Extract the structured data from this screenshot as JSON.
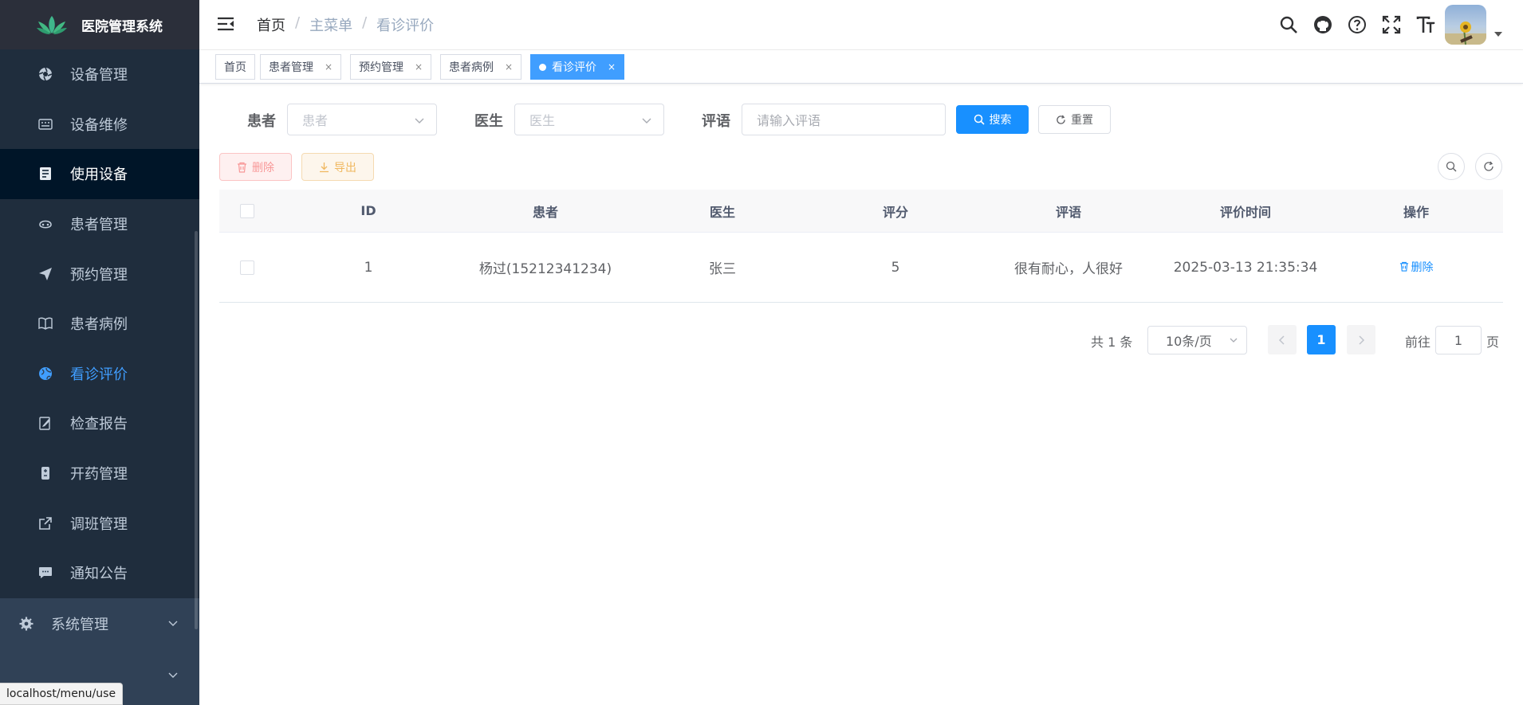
{
  "app": {
    "title": "医院管理系统"
  },
  "sidebar": {
    "items": [
      {
        "label": "设备管理",
        "icon": "aperture-icon"
      },
      {
        "label": "设备维修",
        "icon": "keyboard-icon"
      },
      {
        "label": "使用设备",
        "icon": "document-list-icon"
      },
      {
        "label": "患者管理",
        "icon": "face-icon"
      },
      {
        "label": "预约管理",
        "icon": "paper-plane-icon"
      },
      {
        "label": "患者病例",
        "icon": "book-icon"
      },
      {
        "label": "看诊评价",
        "icon": "globe-icon"
      },
      {
        "label": "检查报告",
        "icon": "edit-icon"
      },
      {
        "label": "开药管理",
        "icon": "pill-icon"
      },
      {
        "label": "调班管理",
        "icon": "external-link-icon"
      },
      {
        "label": "通知公告",
        "icon": "message-icon"
      }
    ],
    "system": {
      "label": "系统管理",
      "icon": "gear-icon"
    },
    "status_url": "localhost/menu/use"
  },
  "navbar": {
    "breadcrumb": {
      "home": "首页",
      "sep": "/",
      "menu": "主菜单",
      "current": "看诊评价"
    }
  },
  "tags": [
    {
      "label": "首页"
    },
    {
      "label": "患者管理",
      "close": "×"
    },
    {
      "label": "预约管理",
      "close": "×"
    },
    {
      "label": "患者病例",
      "close": "×"
    },
    {
      "label": "看诊评价",
      "close": "×"
    }
  ],
  "search": {
    "patient_label": "患者",
    "patient_placeholder": "患者",
    "doctor_label": "医生",
    "doctor_placeholder": "医生",
    "comment_label": "评语",
    "comment_placeholder": "请输入评语",
    "search_btn": "搜索",
    "reset_btn": "重置"
  },
  "toolbar": {
    "delete_btn": "删除",
    "export_btn": "导出"
  },
  "table": {
    "headers": [
      "ID",
      "患者",
      "医生",
      "评分",
      "评语",
      "评价时间",
      "操作"
    ],
    "rows": [
      {
        "id": "1",
        "patient": "杨过(15212341234)",
        "doctor": "张三",
        "score": "5",
        "comment": "很有耐心，人很好",
        "time": "2025-03-13 21:35:34",
        "action": "删除"
      }
    ]
  },
  "pagination": {
    "total": "共 1 条",
    "page_size": "10条/页",
    "current": "1",
    "goto_label": "前往",
    "goto_value": "1",
    "page_suffix": "页"
  },
  "colors": {
    "sidebar_bg": "#304156",
    "active_bg": "#001528",
    "primary": "#1890ff",
    "current_menu": "#409eff"
  }
}
